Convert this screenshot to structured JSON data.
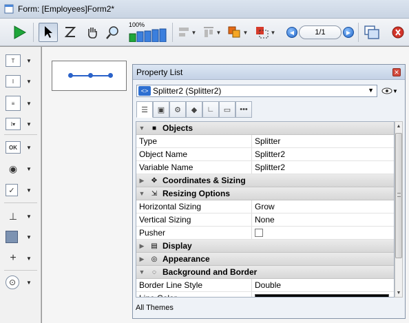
{
  "window": {
    "title": "Form: [Employees]Form2*"
  },
  "toolbar": {
    "zoom_label": "100%",
    "page_indicator": "1/1"
  },
  "palette": {
    "items": [
      {
        "name": "text",
        "glyph": "T"
      },
      {
        "name": "input",
        "glyph": "I"
      },
      {
        "name": "list",
        "glyph": "≡"
      },
      {
        "name": "dropdown",
        "glyph": "I ▾"
      },
      {
        "name": "button",
        "glyph": "OK"
      },
      {
        "name": "radio",
        "glyph": "◉"
      },
      {
        "name": "checkbox",
        "glyph": "✓"
      },
      {
        "name": "splitter-tool",
        "glyph": "⊥"
      },
      {
        "name": "rectangle",
        "glyph": "■"
      },
      {
        "name": "line-tool",
        "glyph": "+"
      },
      {
        "name": "plugin",
        "glyph": "⊙"
      }
    ]
  },
  "property_list": {
    "title": "Property List",
    "object_selector": "Splitter2 (Splitter2)",
    "sections": [
      {
        "kind": "section",
        "label": "Objects",
        "expanded": true
      },
      {
        "kind": "prop",
        "name": "Type",
        "value": "Splitter"
      },
      {
        "kind": "prop",
        "name": "Object Name",
        "value": "Splitter2"
      },
      {
        "kind": "prop",
        "name": "Variable Name",
        "value": "Splitter2"
      },
      {
        "kind": "section",
        "label": "Coordinates & Sizing",
        "expanded": false
      },
      {
        "kind": "section",
        "label": "Resizing Options",
        "expanded": true
      },
      {
        "kind": "prop",
        "name": "Horizontal Sizing",
        "value": "Grow"
      },
      {
        "kind": "prop",
        "name": "Vertical Sizing",
        "value": "None"
      },
      {
        "kind": "prop",
        "name": "Pusher",
        "value": "",
        "checkbox": true,
        "checked": false
      },
      {
        "kind": "section",
        "label": "Display",
        "expanded": false
      },
      {
        "kind": "section",
        "label": "Appearance",
        "expanded": false
      },
      {
        "kind": "section",
        "label": "Background and Border",
        "expanded": true
      },
      {
        "kind": "prop",
        "name": "Border Line Style",
        "value": "Double"
      },
      {
        "kind": "prop",
        "name": "Line Color",
        "value": "",
        "color": "#000000"
      }
    ],
    "footer": "All Themes"
  },
  "colors": {
    "accent_blue": "#2a62c9",
    "run_green": "#1ea63a",
    "close_red": "#d34a3d"
  }
}
